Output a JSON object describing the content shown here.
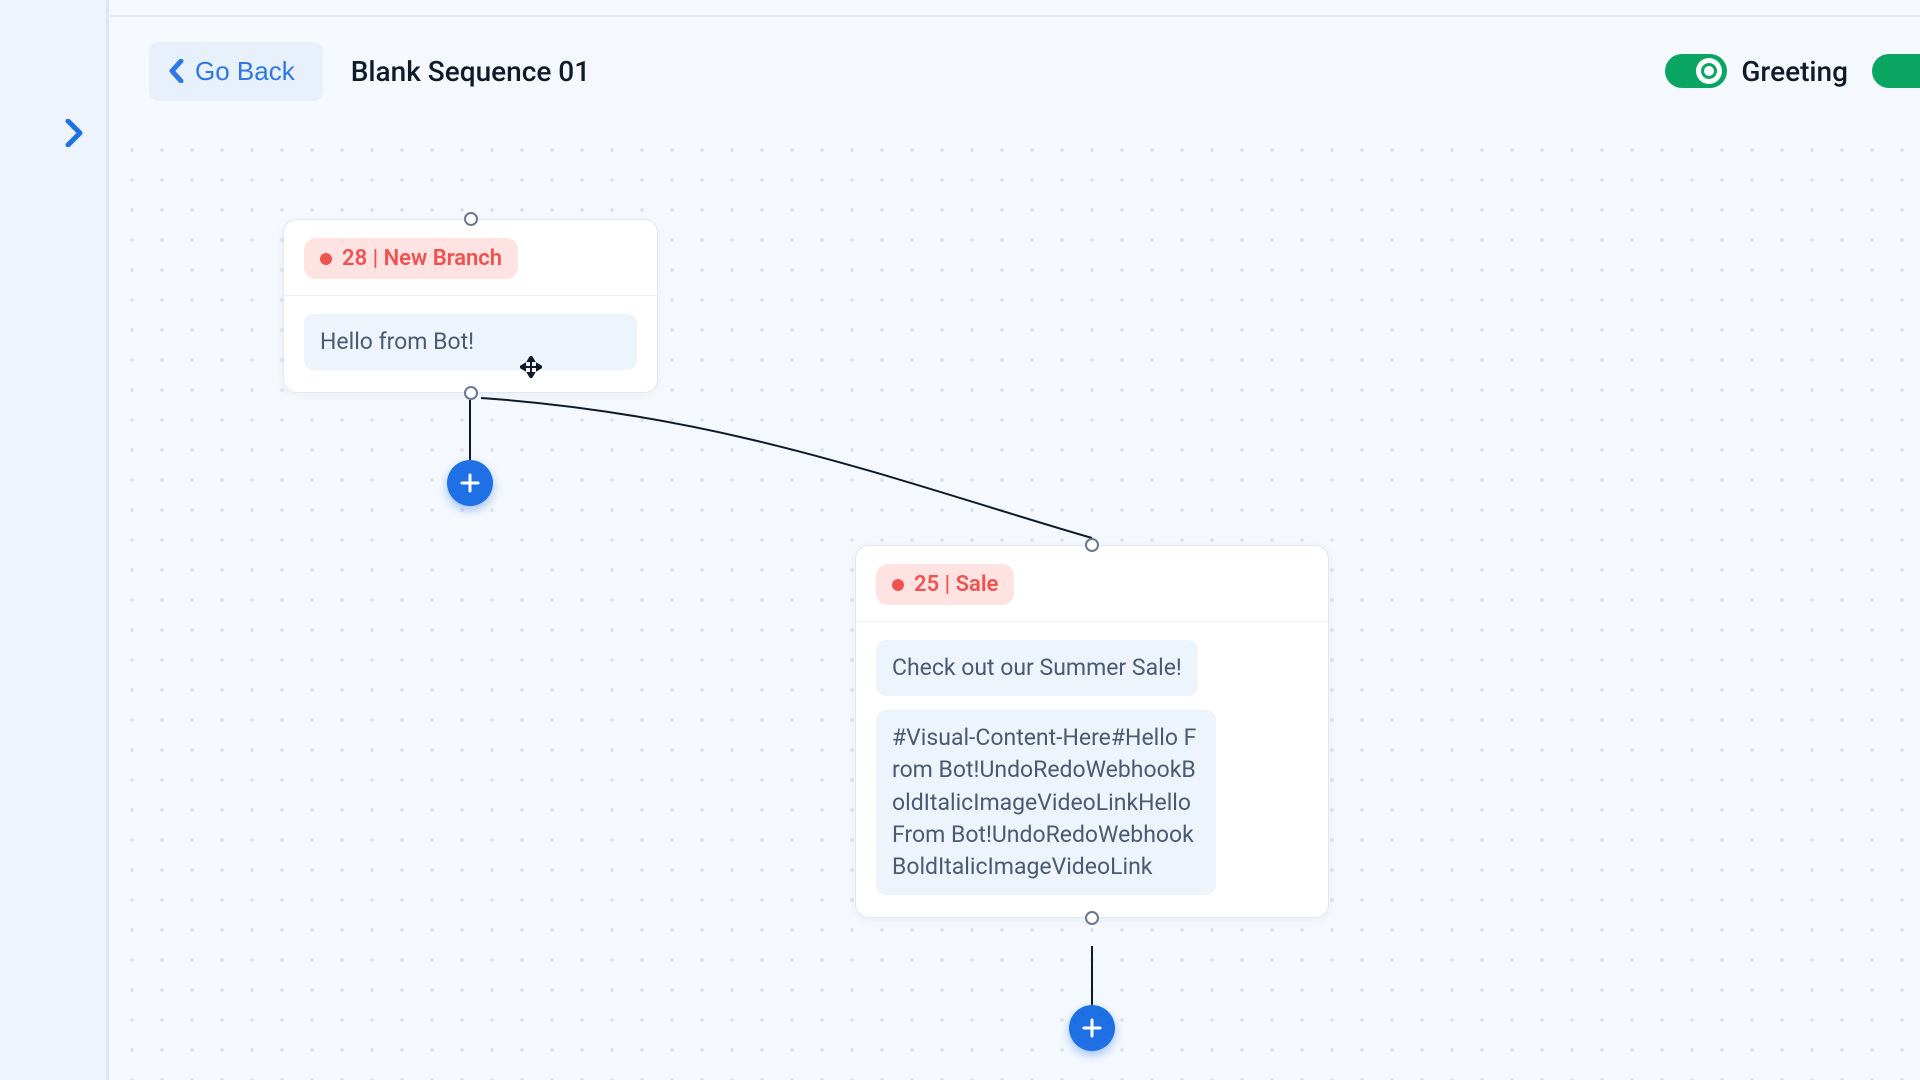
{
  "header": {
    "go_back_label": "Go Back",
    "title": "Blank Sequence 01",
    "toggles": [
      {
        "label": "Greeting",
        "on": true
      }
    ]
  },
  "nodes": {
    "a": {
      "badge_text": "28 | New Branch",
      "messages": [
        "Hello from Bot!"
      ]
    },
    "b": {
      "badge_text": "25 | Sale",
      "messages": [
        "Check out our Summer Sale!",
        "#Visual-Content-Here#Hello From Bot!UndoRedoWebhookBoldItalicImageVideoLinkHello From Bot!UndoRedoWebhookBoldItalicImageVideoLink"
      ]
    }
  },
  "colors": {
    "accent": "#1f6fe5",
    "success": "#0aa562",
    "danger": "#ef5350"
  }
}
